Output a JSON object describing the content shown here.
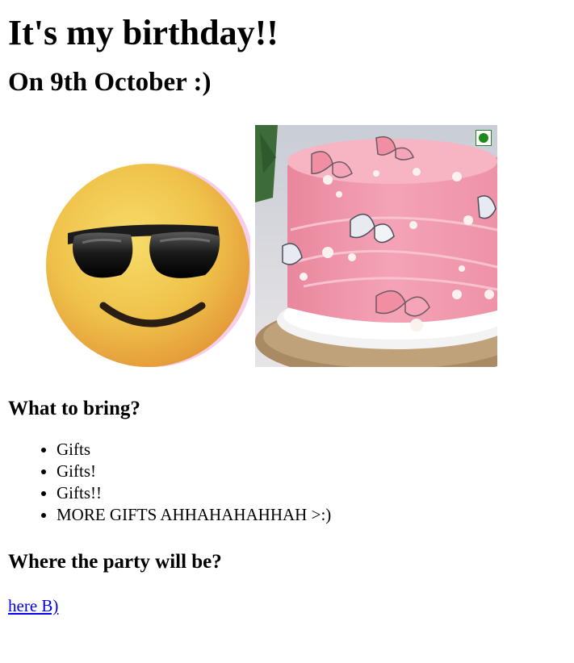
{
  "page": {
    "title": "It's my birthday!!",
    "subtitle": "On 9th October :)"
  },
  "images": {
    "emoji_icon": "sunglasses-smiley-icon",
    "cake_icon": "pink-butterfly-cake-image",
    "badge_color": "#1e8a1e"
  },
  "bring": {
    "heading": "What to bring?",
    "items": [
      "Gifts",
      "Gifts!",
      "Gifts!!",
      "MORE GIFTS AHHAHAHAHHAH >:)"
    ]
  },
  "party": {
    "heading": "Where the party will be?",
    "link_text": "here B)"
  },
  "colors": {
    "link": "#0000ee",
    "cake_pink": "#f29aae"
  }
}
